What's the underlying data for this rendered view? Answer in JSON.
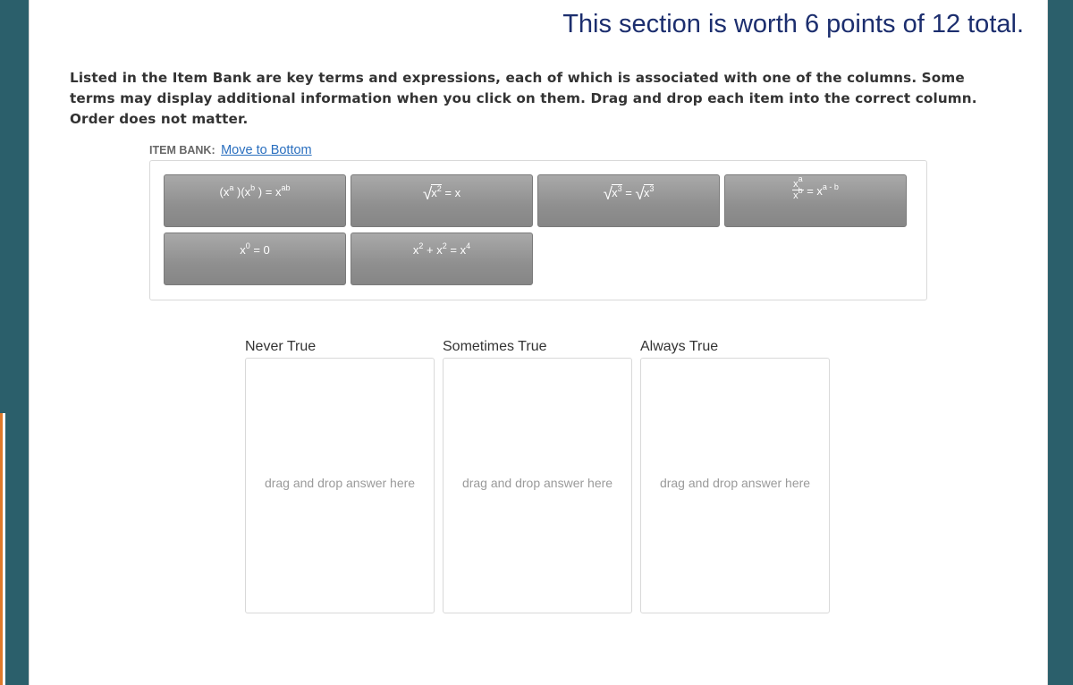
{
  "section_title": "This section is worth 6 points of 12 total.",
  "instructions": "Listed in the Item Bank are key terms and expressions, each of which is associated with one of the columns. Some terms may display additional information when you click on them. Drag and drop each item into the correct column. Order does not matter.",
  "item_bank": {
    "label": "ITEM BANK:",
    "move_link": "Move to Bottom",
    "items": [
      {
        "expression": "(x^a)(x^b) = x^ab"
      },
      {
        "expression": "√(x^2) = x"
      },
      {
        "expression": "√(x^3) = √(x^3)"
      },
      {
        "expression": "x^a / x^b = x^(a - b)"
      },
      {
        "expression": "x^0 = 0"
      },
      {
        "expression": "x^2 + x^2 = x^4"
      }
    ]
  },
  "columns": [
    {
      "label": "Never True",
      "placeholder": "drag and drop answer here"
    },
    {
      "label": "Sometimes True",
      "placeholder": "drag and drop answer here"
    },
    {
      "label": "Always True",
      "placeholder": "drag and drop answer here"
    }
  ],
  "colors": {
    "title": "#1c2e6e",
    "tile": "#9a9a9a",
    "link": "#2a6fbf",
    "background": "#2b5f6b"
  }
}
